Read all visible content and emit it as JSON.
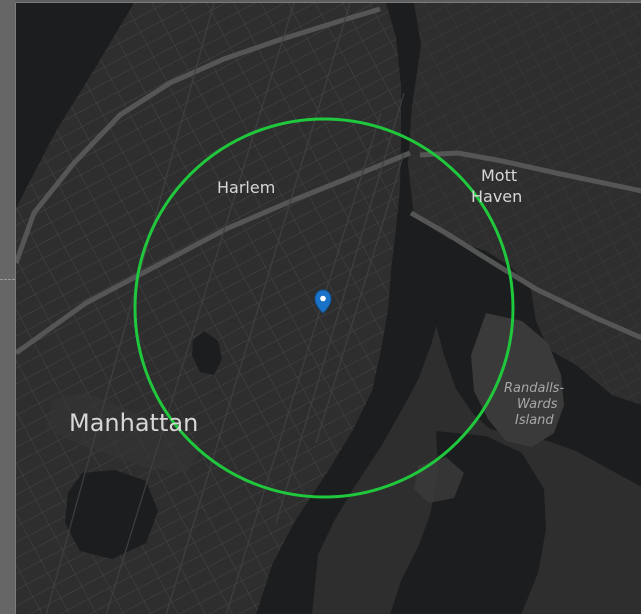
{
  "map": {
    "labels": {
      "harlem": "Harlem",
      "mott_haven_line1": "Mott",
      "mott_haven_line2": "Haven",
      "manhattan": "Manhattan",
      "randalls_line1": "Randalls-",
      "randalls_line2": "Wards",
      "randalls_line3": "Island"
    },
    "colors": {
      "land": "#2f2f2f",
      "water": "#1b1d1f",
      "park": "#3b3b3b",
      "street": "#4a4a4a",
      "street_major": "#5a5a5a",
      "radius_circle": "#1fc83c",
      "marker": "#1a73c8"
    },
    "marker": {
      "icon": "map-pin-icon"
    },
    "radius_overlay": {
      "shape": "circle"
    }
  }
}
